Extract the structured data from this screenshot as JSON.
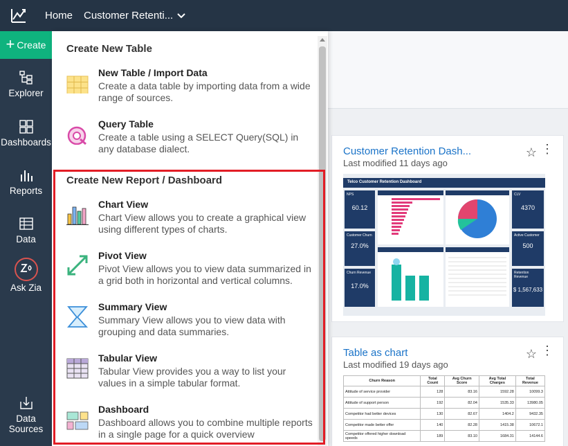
{
  "topbar": {
    "home_label": "Home",
    "workspace_label": "Customer Retenti..."
  },
  "sidebar": {
    "create_label": "Create",
    "items": [
      {
        "label": "Explorer",
        "icon": "explorer-icon"
      },
      {
        "label": "Dashboards",
        "icon": "dashboards-icon"
      },
      {
        "label": "Reports",
        "icon": "reports-icon"
      },
      {
        "label": "Data",
        "icon": "data-icon"
      },
      {
        "label": "Ask Zia",
        "icon": "zia-icon"
      },
      {
        "label": "Data\nSources",
        "icon": "data-sources-icon"
      }
    ]
  },
  "menu": {
    "section1_title": "Create New Table",
    "section2_title": "Create New Report / Dashboard",
    "items": [
      {
        "title": "New Table / Import Data",
        "desc": "Create a data table by importing data from a wide range of sources.",
        "icon": "table-grid-icon"
      },
      {
        "title": "Query Table",
        "desc": "Create a table using a SELECT Query(SQL) in any database dialect.",
        "icon": "query-icon"
      },
      {
        "title": "Chart View",
        "desc": "Chart View allows you to create a graphical view using different types of charts.",
        "icon": "chart-bars-icon"
      },
      {
        "title": "Pivot View",
        "desc": "Pivot View allows you to view data summarized in a grid both in horizontal and vertical columns.",
        "icon": "pivot-arrows-icon"
      },
      {
        "title": "Summary View",
        "desc": "Summary View allows you to view data with grouping and data summaries.",
        "icon": "sigma-icon"
      },
      {
        "title": "Tabular View",
        "desc": "Tabular View provides you a way to list your values in a simple tabular format.",
        "icon": "tabular-icon"
      },
      {
        "title": "Dashboard",
        "desc": "Dashboard allows you to combine multiple reports in a single page for a quick overview",
        "icon": "dashboard-tiles-icon"
      }
    ]
  },
  "cards": [
    {
      "title": "Customer Retention Dash...",
      "modified": "Last modified 11 days ago",
      "thumb": {
        "title": "Telco Customer Retention Dashboard",
        "kpis_left": [
          {
            "label": "NPS",
            "value": "60.12"
          },
          {
            "label": "Customer Churn",
            "value": "27.0%"
          },
          {
            "label": "Churn Revenue",
            "value": "17.0%"
          }
        ],
        "kpis_right": [
          {
            "label": "CLV",
            "value": "4370"
          },
          {
            "label": "Active Customer",
            "value": "500"
          },
          {
            "label": "Retention Revenue",
            "value": "$ 1,567,633"
          }
        ]
      }
    },
    {
      "title": "Table as chart",
      "modified": "Last modified 19 days ago",
      "table": {
        "headers": [
          "Churn Reason",
          "Total Count",
          "Avg Churn Score",
          "Avg Total Charges",
          "Total Revenue"
        ],
        "rows": [
          [
            "Attitude of service provider",
            "128",
            "83.16",
            "1592.28",
            "10099.3"
          ],
          [
            "Attitude of support person",
            "192",
            "82.04",
            "1535.33",
            "13980.05"
          ],
          [
            "Competitor had better devices",
            "130",
            "82.67",
            "1404.2",
            "9432.35"
          ],
          [
            "Competitor made better offer",
            "140",
            "82.28",
            "1415.38",
            "10672.1"
          ],
          [
            "Competitor offered higher download speeds",
            "189",
            "83.10",
            "1684.31",
            "14144.6"
          ]
        ]
      }
    }
  ],
  "colors": {
    "topbar": "#253445",
    "sidebar": "#2a3a4c",
    "create": "#0fb37e",
    "link": "#1a73c8",
    "highlight": "#e21d25"
  }
}
